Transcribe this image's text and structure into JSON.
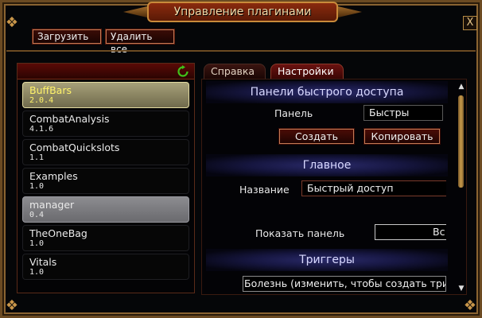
{
  "window": {
    "title": "Управление плагинами",
    "close_label": "X"
  },
  "toolbar": {
    "load_label": "Загрузить",
    "delete_all_label": "Удалить все"
  },
  "plugins": [
    {
      "name": "BuffBars",
      "version": "2.0.4",
      "state": "selected"
    },
    {
      "name": "CombatAnalysis",
      "version": "4.1.6",
      "state": "normal"
    },
    {
      "name": "CombatQuickslots",
      "version": "1.1",
      "state": "normal"
    },
    {
      "name": "Examples",
      "version": "1.0",
      "state": "normal"
    },
    {
      "name": "manager",
      "version": "0.4",
      "state": "highlight"
    },
    {
      "name": "TheOneBag",
      "version": "1.0",
      "state": "normal"
    },
    {
      "name": "Vitals",
      "version": "1.0",
      "state": "normal"
    }
  ],
  "tabs": {
    "help": "Справка",
    "settings": "Настройки"
  },
  "settings": {
    "quickbar_header": "Панели быстрого доступа",
    "panel_label": "Панель",
    "panel_value": "Быстры",
    "create_label": "Создать",
    "copy_label": "Копировать",
    "main_header": "Главное",
    "name_label": "Название",
    "name_value": "Быстрый доступ",
    "show_panel_label": "Показать панель",
    "show_panel_value": "Вс",
    "triggers_header": "Триггеры",
    "trigger_value": "Болезнь (изменить, чтобы создать три"
  },
  "icons": {
    "refresh": "refresh-icon",
    "scroll_up": "arrow-up-icon",
    "scroll_down": "arrow-down-icon"
  },
  "colors": {
    "accent_gold": "#c98a3a",
    "selected_text": "#fff36a",
    "button_border": "#c37a55",
    "refresh_green": "#3fc21a"
  }
}
